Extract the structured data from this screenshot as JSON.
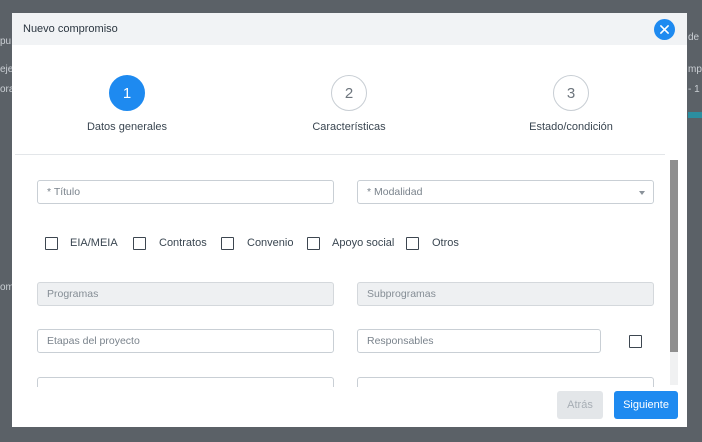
{
  "background": {
    "fragments": [
      "pu",
      "eje",
      "ora",
      "om",
      "de",
      "o de",
      "mpr",
      "- 1"
    ]
  },
  "modal": {
    "title": "Nuevo compromiso",
    "close_icon": "close-icon"
  },
  "stepper": {
    "steps": [
      {
        "number": "1",
        "label": "Datos generales",
        "active": true
      },
      {
        "number": "2",
        "label": "Características",
        "active": false
      },
      {
        "number": "3",
        "label": "Estado/condición",
        "active": false
      }
    ]
  },
  "form": {
    "titulo_placeholder": "* Título",
    "modalidad_placeholder": "* Modalidad",
    "checkboxes": [
      "EIA/MEIA",
      "Contratos",
      "Convenio",
      "Apoyo social",
      "Otros"
    ],
    "programas_placeholder": "Programas",
    "subprogramas_placeholder": "Subprogramas",
    "etapas_placeholder": "Etapas del proyecto",
    "responsables_placeholder": "Responsables"
  },
  "footer": {
    "back_label": "Atrás",
    "next_label": "Siguiente"
  },
  "colors": {
    "accent": "#1e8af0",
    "overlay": "#5b6167"
  }
}
